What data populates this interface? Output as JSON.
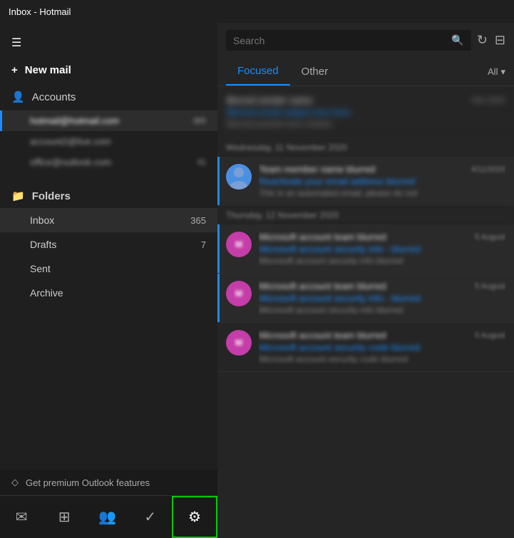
{
  "titleBar": {
    "text": "Inbox - Hotmail"
  },
  "sidebar": {
    "menuIcon": "☰",
    "newMail": {
      "icon": "+",
      "label": "New mail"
    },
    "accounts": {
      "icon": "👤",
      "label": "Accounts",
      "items": [
        {
          "name": "Hotmail account",
          "badge": "365",
          "active": true
        },
        {
          "name": "Account 2",
          "badge": "",
          "active": false
        },
        {
          "name": "Office",
          "badge": "41",
          "active": false
        }
      ]
    },
    "folders": {
      "icon": "📁",
      "label": "Folders",
      "items": [
        {
          "name": "Inbox",
          "count": "365",
          "active": true
        },
        {
          "name": "Drafts",
          "count": "7",
          "active": false
        },
        {
          "name": "Sent",
          "count": "",
          "active": false
        },
        {
          "name": "Archive",
          "count": "",
          "active": false
        }
      ]
    },
    "premium": {
      "icon": "◇",
      "label": "Get premium Outlook features"
    }
  },
  "bottomNav": {
    "items": [
      {
        "icon": "✉",
        "name": "mail-nav",
        "label": "Mail"
      },
      {
        "icon": "⊞",
        "name": "calendar-nav",
        "label": "Calendar"
      },
      {
        "icon": "👥",
        "name": "people-nav",
        "label": "People"
      },
      {
        "icon": "✓",
        "name": "tasks-nav",
        "label": "Tasks"
      },
      {
        "icon": "⚙",
        "name": "settings-nav",
        "label": "Settings",
        "active": true
      }
    ]
  },
  "rightPanel": {
    "search": {
      "placeholder": "Search",
      "refreshIcon": "↻",
      "filterIcon": "⊟"
    },
    "tabs": [
      {
        "label": "Focused",
        "active": true
      },
      {
        "label": "Other",
        "active": false
      }
    ],
    "allDropdown": "All",
    "emails": [
      {
        "separator": "Wednesday, 11 November 2020"
      },
      {
        "sender": "Team member name",
        "subject": "Reactivate your email address",
        "preview": "This is an automated email, please",
        "time": "4/11/2020",
        "avatarType": "user",
        "unread": true
      },
      {
        "separator": "Thursday, 12 November 2020"
      },
      {
        "sender": "Microsoft account team",
        "subject": "Microsoft account security info - 1/17/2020",
        "preview": "Microsoft account security info",
        "time": "5 August",
        "avatarType": "team",
        "unread": true
      },
      {
        "sender": "Microsoft account team",
        "subject": "Microsoft account security info - 1/17/2020",
        "preview": "Microsoft account security info",
        "time": "5 August",
        "avatarType": "team",
        "unread": true
      },
      {
        "sender": "Microsoft account team",
        "subject": "Microsoft account security code",
        "preview": "Microsoft account security code",
        "time": "5 August",
        "avatarType": "team",
        "unread": false
      }
    ]
  }
}
